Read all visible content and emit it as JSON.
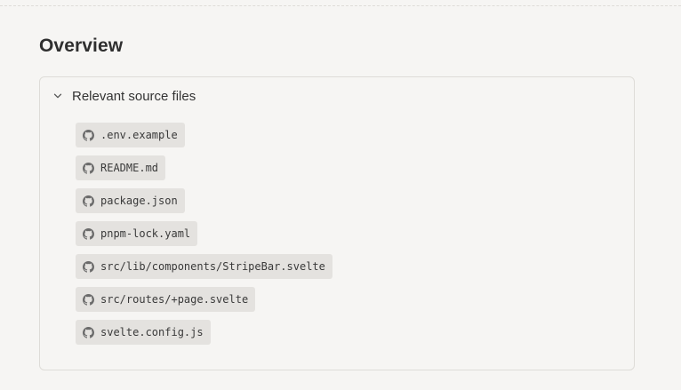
{
  "page": {
    "title": "Overview"
  },
  "source_panel": {
    "summary_label": "Relevant source files",
    "expanded": true,
    "files": [
      {
        "name": ".env.example",
        "icon": "github-icon"
      },
      {
        "name": "README.md",
        "icon": "github-icon"
      },
      {
        "name": "package.json",
        "icon": "github-icon"
      },
      {
        "name": "pnpm-lock.yaml",
        "icon": "github-icon"
      },
      {
        "name": "src/lib/components/StripeBar.svelte",
        "icon": "github-icon"
      },
      {
        "name": "src/routes/+page.svelte",
        "icon": "github-icon"
      },
      {
        "name": "svelte.config.js",
        "icon": "github-icon"
      }
    ]
  },
  "colors": {
    "background": "#f6f5f3",
    "chip_background": "#e4e2df",
    "border": "#dedcd8",
    "text": "#2f2f2f"
  }
}
